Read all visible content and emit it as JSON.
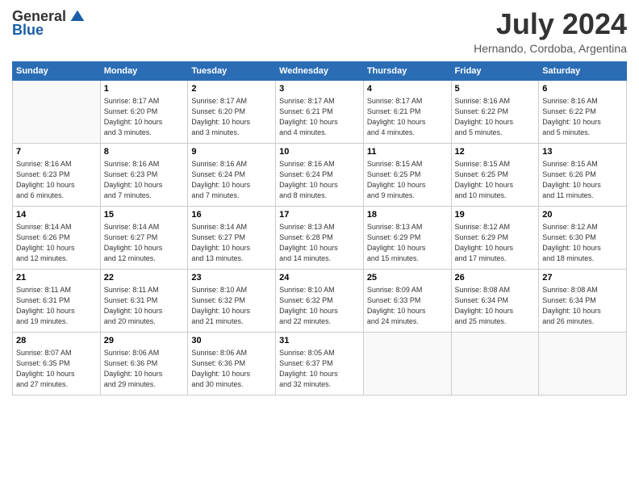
{
  "logo": {
    "general": "General",
    "blue": "Blue"
  },
  "title": "July 2024",
  "location": "Hernando, Cordoba, Argentina",
  "days_of_week": [
    "Sunday",
    "Monday",
    "Tuesday",
    "Wednesday",
    "Thursday",
    "Friday",
    "Saturday"
  ],
  "weeks": [
    [
      {
        "day": "",
        "info": ""
      },
      {
        "day": "1",
        "info": "Sunrise: 8:17 AM\nSunset: 6:20 PM\nDaylight: 10 hours\nand 3 minutes."
      },
      {
        "day": "2",
        "info": "Sunrise: 8:17 AM\nSunset: 6:20 PM\nDaylight: 10 hours\nand 3 minutes."
      },
      {
        "day": "3",
        "info": "Sunrise: 8:17 AM\nSunset: 6:21 PM\nDaylight: 10 hours\nand 4 minutes."
      },
      {
        "day": "4",
        "info": "Sunrise: 8:17 AM\nSunset: 6:21 PM\nDaylight: 10 hours\nand 4 minutes."
      },
      {
        "day": "5",
        "info": "Sunrise: 8:16 AM\nSunset: 6:22 PM\nDaylight: 10 hours\nand 5 minutes."
      },
      {
        "day": "6",
        "info": "Sunrise: 8:16 AM\nSunset: 6:22 PM\nDaylight: 10 hours\nand 5 minutes."
      }
    ],
    [
      {
        "day": "7",
        "info": "Sunrise: 8:16 AM\nSunset: 6:23 PM\nDaylight: 10 hours\nand 6 minutes."
      },
      {
        "day": "8",
        "info": "Sunrise: 8:16 AM\nSunset: 6:23 PM\nDaylight: 10 hours\nand 7 minutes."
      },
      {
        "day": "9",
        "info": "Sunrise: 8:16 AM\nSunset: 6:24 PM\nDaylight: 10 hours\nand 7 minutes."
      },
      {
        "day": "10",
        "info": "Sunrise: 8:16 AM\nSunset: 6:24 PM\nDaylight: 10 hours\nand 8 minutes."
      },
      {
        "day": "11",
        "info": "Sunrise: 8:15 AM\nSunset: 6:25 PM\nDaylight: 10 hours\nand 9 minutes."
      },
      {
        "day": "12",
        "info": "Sunrise: 8:15 AM\nSunset: 6:25 PM\nDaylight: 10 hours\nand 10 minutes."
      },
      {
        "day": "13",
        "info": "Sunrise: 8:15 AM\nSunset: 6:26 PM\nDaylight: 10 hours\nand 11 minutes."
      }
    ],
    [
      {
        "day": "14",
        "info": "Sunrise: 8:14 AM\nSunset: 6:26 PM\nDaylight: 10 hours\nand 12 minutes."
      },
      {
        "day": "15",
        "info": "Sunrise: 8:14 AM\nSunset: 6:27 PM\nDaylight: 10 hours\nand 12 minutes."
      },
      {
        "day": "16",
        "info": "Sunrise: 8:14 AM\nSunset: 6:27 PM\nDaylight: 10 hours\nand 13 minutes."
      },
      {
        "day": "17",
        "info": "Sunrise: 8:13 AM\nSunset: 6:28 PM\nDaylight: 10 hours\nand 14 minutes."
      },
      {
        "day": "18",
        "info": "Sunrise: 8:13 AM\nSunset: 6:29 PM\nDaylight: 10 hours\nand 15 minutes."
      },
      {
        "day": "19",
        "info": "Sunrise: 8:12 AM\nSunset: 6:29 PM\nDaylight: 10 hours\nand 17 minutes."
      },
      {
        "day": "20",
        "info": "Sunrise: 8:12 AM\nSunset: 6:30 PM\nDaylight: 10 hours\nand 18 minutes."
      }
    ],
    [
      {
        "day": "21",
        "info": "Sunrise: 8:11 AM\nSunset: 6:31 PM\nDaylight: 10 hours\nand 19 minutes."
      },
      {
        "day": "22",
        "info": "Sunrise: 8:11 AM\nSunset: 6:31 PM\nDaylight: 10 hours\nand 20 minutes."
      },
      {
        "day": "23",
        "info": "Sunrise: 8:10 AM\nSunset: 6:32 PM\nDaylight: 10 hours\nand 21 minutes."
      },
      {
        "day": "24",
        "info": "Sunrise: 8:10 AM\nSunset: 6:32 PM\nDaylight: 10 hours\nand 22 minutes."
      },
      {
        "day": "25",
        "info": "Sunrise: 8:09 AM\nSunset: 6:33 PM\nDaylight: 10 hours\nand 24 minutes."
      },
      {
        "day": "26",
        "info": "Sunrise: 8:08 AM\nSunset: 6:34 PM\nDaylight: 10 hours\nand 25 minutes."
      },
      {
        "day": "27",
        "info": "Sunrise: 8:08 AM\nSunset: 6:34 PM\nDaylight: 10 hours\nand 26 minutes."
      }
    ],
    [
      {
        "day": "28",
        "info": "Sunrise: 8:07 AM\nSunset: 6:35 PM\nDaylight: 10 hours\nand 27 minutes."
      },
      {
        "day": "29",
        "info": "Sunrise: 8:06 AM\nSunset: 6:36 PM\nDaylight: 10 hours\nand 29 minutes."
      },
      {
        "day": "30",
        "info": "Sunrise: 8:06 AM\nSunset: 6:36 PM\nDaylight: 10 hours\nand 30 minutes."
      },
      {
        "day": "31",
        "info": "Sunrise: 8:05 AM\nSunset: 6:37 PM\nDaylight: 10 hours\nand 32 minutes."
      },
      {
        "day": "",
        "info": ""
      },
      {
        "day": "",
        "info": ""
      },
      {
        "day": "",
        "info": ""
      }
    ]
  ]
}
